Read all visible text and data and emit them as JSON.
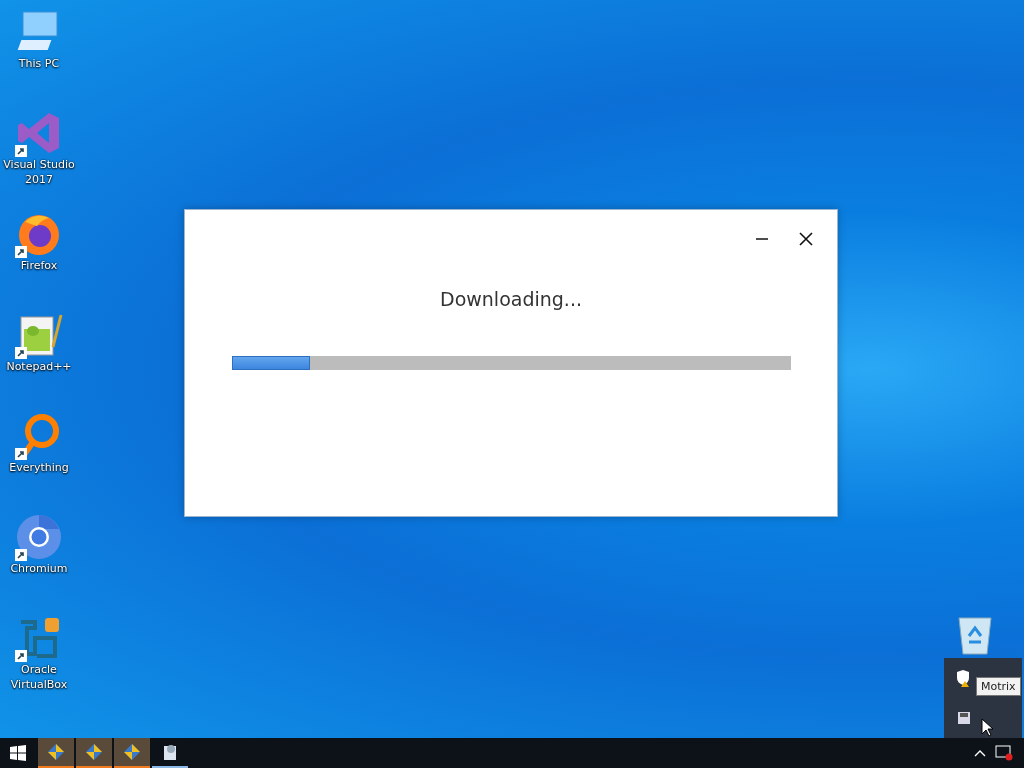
{
  "desktop_icons": [
    {
      "kind": "computer",
      "label": "This PC",
      "shortcut": false
    },
    {
      "kind": "ide",
      "label": "Visual Studio 2017",
      "shortcut": true
    },
    {
      "kind": "firefox",
      "label": "Firefox",
      "shortcut": true
    },
    {
      "kind": "notepad",
      "label": "Notepad++",
      "shortcut": true
    },
    {
      "kind": "magnifier",
      "label": "Everything",
      "shortcut": true
    },
    {
      "kind": "chromium",
      "label": "Chromium",
      "shortcut": true
    },
    {
      "kind": "virtualbox",
      "label": "Oracle VirtualBox",
      "shortcut": true
    }
  ],
  "dialog": {
    "message": "Downloading...",
    "progress": {
      "level": 0.14
    }
  },
  "tray_overflow": {
    "tooltip": "Motrix"
  },
  "taskbar": {
    "apps": [
      {
        "flashing": true
      },
      {
        "flashing": true
      },
      {
        "flashing": true
      },
      {
        "flashing": false
      }
    ]
  }
}
